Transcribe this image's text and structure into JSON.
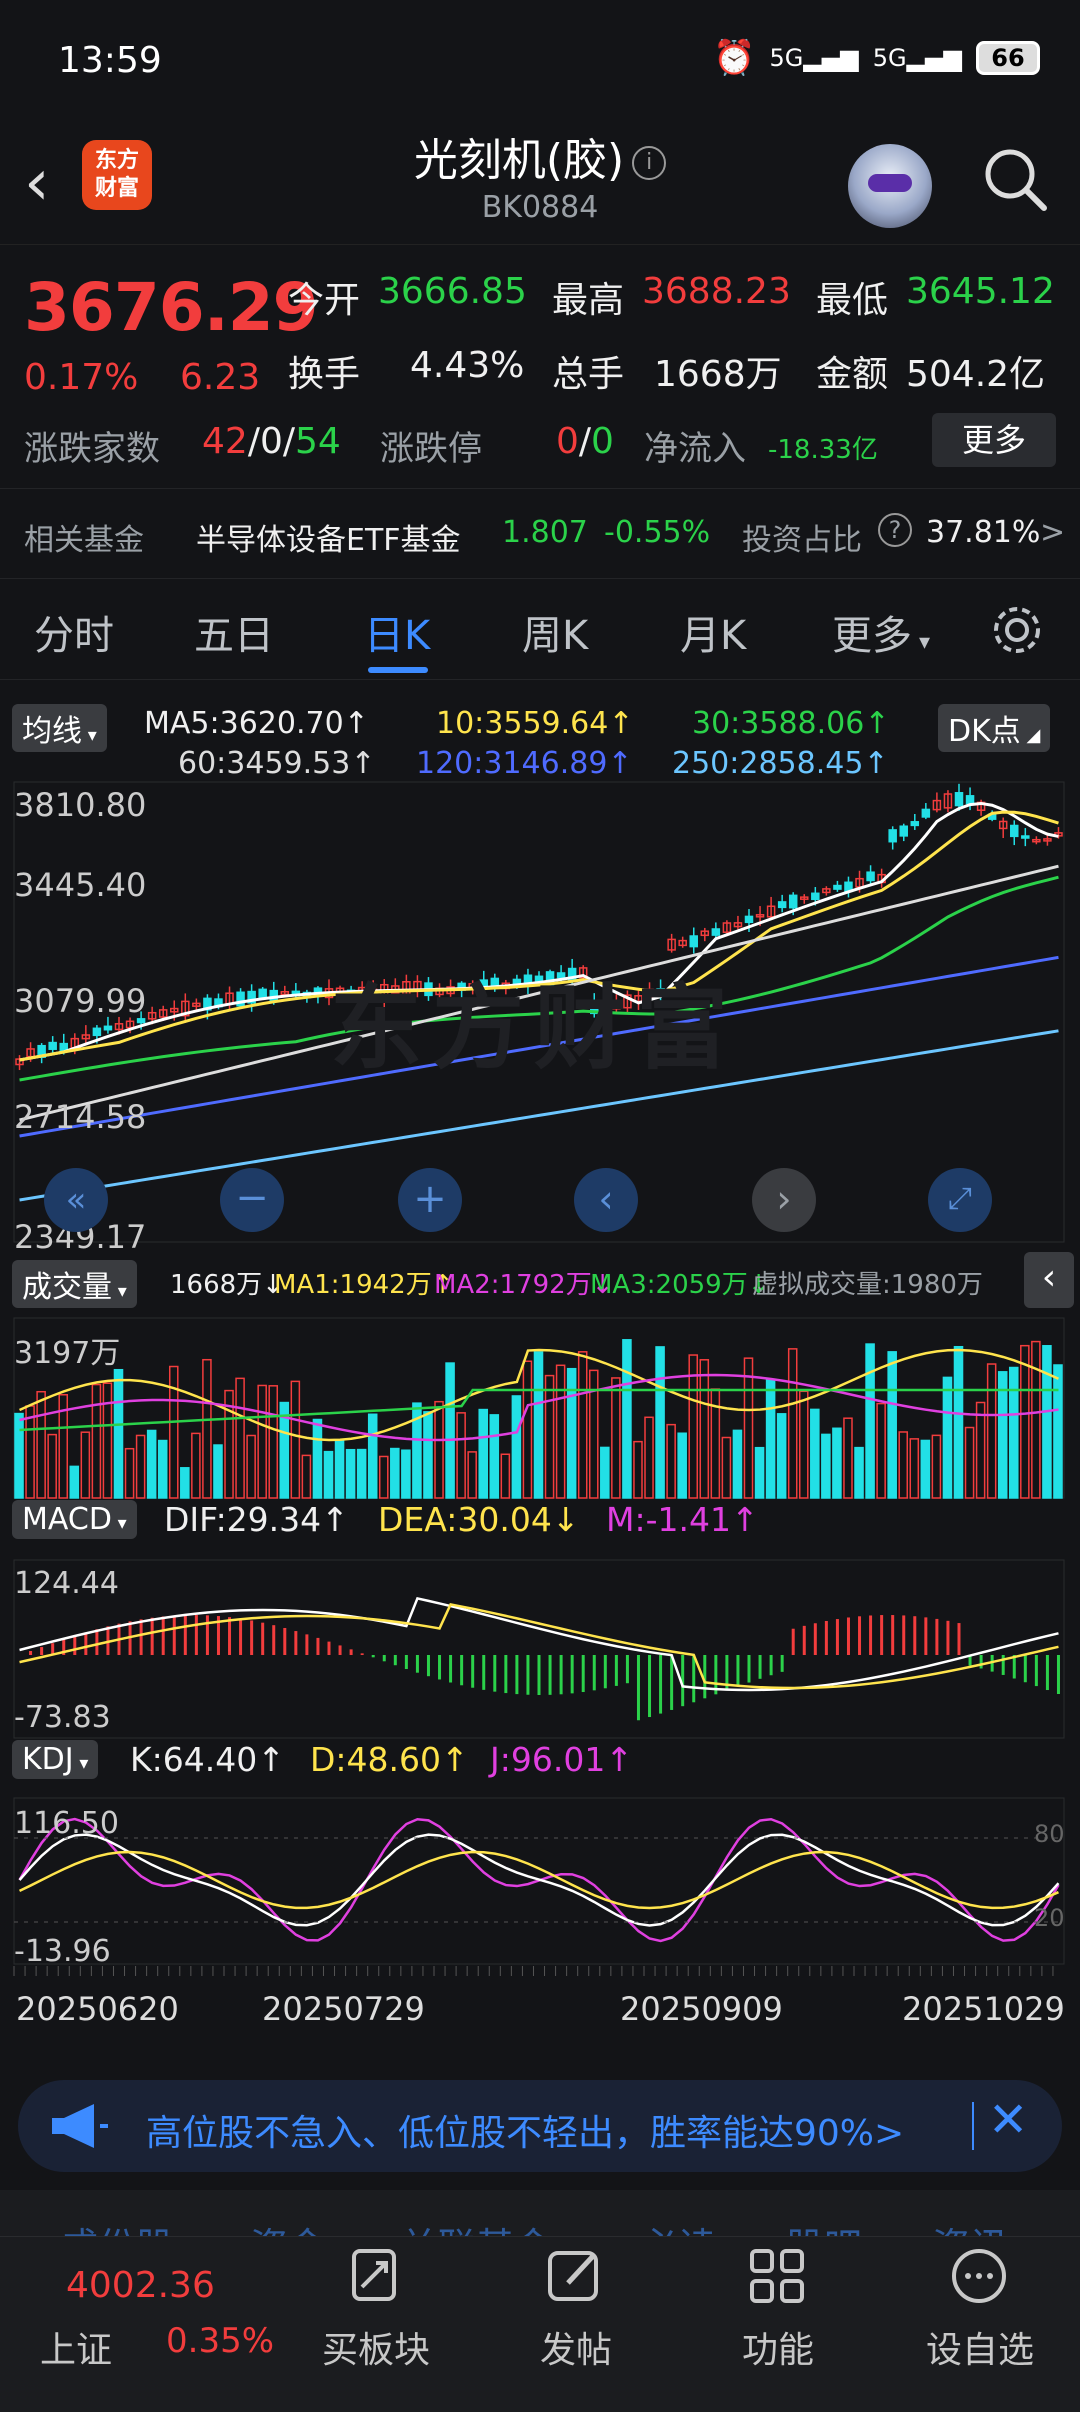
{
  "status": {
    "time": "13:59",
    "sig1": "5G",
    "sig2": "5G",
    "battery": "66"
  },
  "nav": {
    "back": "‹",
    "logo_line1": "东方",
    "logo_line2": "财富",
    "title": "光刻机(胶)",
    "code": "BK0884",
    "info": "i"
  },
  "quote": {
    "price": "3676.29",
    "change_pct": "0.17%",
    "change": "6.23",
    "open_label": "今开",
    "open": "3666.85",
    "high_label": "最高",
    "high": "3688.23",
    "low_label": "最低",
    "low": "3645.12",
    "turnover_label": "换手",
    "turnover": "4.43%",
    "volume_label": "总手",
    "volume": "1668万",
    "amount_label": "金额",
    "amount": "504.2亿",
    "breadth_label": "涨跌家数",
    "up": "42",
    "flat": "0",
    "down": "54",
    "limit_label": "涨跌停",
    "limit_up": "0",
    "limit_down": "0",
    "netflow_label": "净流入",
    "netflow": "-18.33亿",
    "more": "更多"
  },
  "fund": {
    "label": "相关基金",
    "name": "半导体设备ETF基金",
    "price": "1.807",
    "pct": "-0.55%",
    "ratio_label": "投资占比",
    "ratio": "37.81%",
    "arrow": ">"
  },
  "tabs": [
    "分时",
    "五日",
    "日K",
    "周K",
    "月K",
    "更多"
  ],
  "ma": {
    "chip": "均线",
    "ma5": "MA5:3620.70↑",
    "ma10": "10:3559.64↑",
    "ma30": "30:3588.06↑",
    "ma60": "60:3459.53↑",
    "ma120": "120:3146.89↑",
    "ma250": "250:2858.45↑",
    "dk": "DK点"
  },
  "price_axis": [
    "3810.80",
    "3445.40",
    "3079.99",
    "2714.58",
    "2349.17"
  ],
  "vol": {
    "chip": "成交量",
    "cur": "1668万↓",
    "ma1": "MA1:1942万↑",
    "ma2": "MA2:1792万↓",
    "ma3": "MA3:2059万↓",
    "virtual": "虚拟成交量:1980万",
    "max": "3197万"
  },
  "macd": {
    "chip": "MACD",
    "dif": "DIF:29.34↑",
    "dea": "DEA:30.04↓",
    "m": "M:-1.41↑",
    "top": "124.44",
    "bottom": "-73.83"
  },
  "kdj": {
    "chip": "KDJ",
    "k": "K:64.40↑",
    "d": "D:48.60↑",
    "j": "J:96.01↑",
    "top": "116.50",
    "bottom": "-13.96",
    "l80": "80",
    "l20": "20"
  },
  "dates": [
    "20250620",
    "20250729",
    "20250909",
    "20251029"
  ],
  "watermark": "东方财富",
  "banner": {
    "text": "高位股不急入、低位股不轻出，胜率能达90%>"
  },
  "bottom": {
    "ghost": [
      "成份股",
      "资金",
      "关联基金",
      "必读",
      "股吧",
      "资讯"
    ],
    "index_value": "4002.36",
    "index_name": "上证",
    "index_pct": "0.35%",
    "items": [
      "买板块",
      "发帖",
      "功能",
      "设自选"
    ]
  },
  "colors": {
    "up": "#f23d3d",
    "down": "#2bd24a",
    "accent": "#3d8bff"
  }
}
